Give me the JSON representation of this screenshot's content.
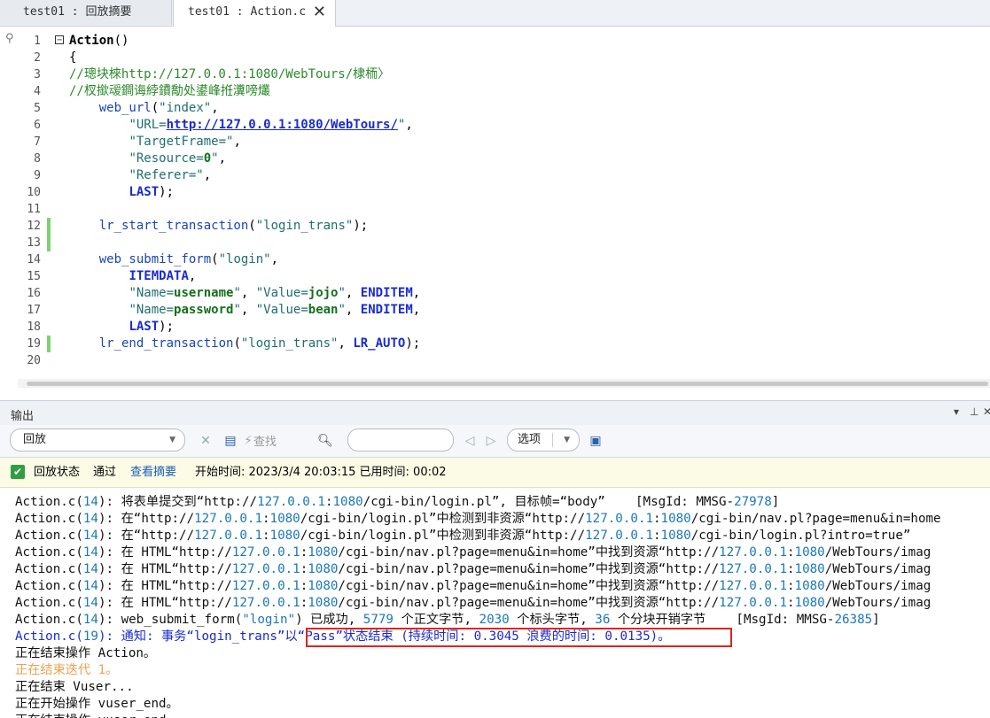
{
  "tabs": [
    {
      "label": "test01 : 回放摘要",
      "active": false
    },
    {
      "label": "test01 : Action.c",
      "active": true
    }
  ],
  "editor": {
    "lines": [
      {
        "num": "1",
        "parts": [
          {
            "t": "Action",
            "c": "k-fn"
          },
          {
            "t": "()",
            "c": ""
          }
        ]
      },
      {
        "num": "2",
        "parts": [
          {
            "t": "{",
            "c": ""
          }
        ]
      },
      {
        "num": "3",
        "parts": [
          {
            "t": "//璁块棶http://127.0.0.1:1080/WebTours/棣栭〉",
            "c": "k-cmt"
          }
        ]
      },
      {
        "num": "4",
        "parts": [
          {
            "t": "//杈撳叆鐧诲綍鐨勪处鍙峰拰瀵嗙爜",
            "c": "k-cmt"
          }
        ]
      },
      {
        "num": "5",
        "parts": [
          {
            "t": "    ",
            "c": ""
          },
          {
            "t": "web_url",
            "c": "k-call"
          },
          {
            "t": "(",
            "c": ""
          },
          {
            "t": "\"index\"",
            "c": "k-str"
          },
          {
            "t": ",",
            "c": ""
          }
        ]
      },
      {
        "num": "6",
        "parts": [
          {
            "t": "        ",
            "c": ""
          },
          {
            "t": "\"URL=",
            "c": "k-str"
          },
          {
            "t": "http://127.0.0.1:1080/WebTours/",
            "c": "k-url"
          },
          {
            "t": "\"",
            "c": "k-str"
          },
          {
            "t": ",",
            "c": ""
          }
        ]
      },
      {
        "num": "7",
        "parts": [
          {
            "t": "        ",
            "c": ""
          },
          {
            "t": "\"TargetFrame=\"",
            "c": "k-str"
          },
          {
            "t": ",",
            "c": ""
          }
        ]
      },
      {
        "num": "8",
        "parts": [
          {
            "t": "        ",
            "c": ""
          },
          {
            "t": "\"Resource=",
            "c": "k-str"
          },
          {
            "t": "0",
            "c": "k-bold"
          },
          {
            "t": "\"",
            "c": "k-str"
          },
          {
            "t": ",",
            "c": ""
          }
        ]
      },
      {
        "num": "9",
        "parts": [
          {
            "t": "        ",
            "c": ""
          },
          {
            "t": "\"Referer=\"",
            "c": "k-str"
          },
          {
            "t": ",",
            "c": ""
          }
        ]
      },
      {
        "num": "10",
        "parts": [
          {
            "t": "        ",
            "c": ""
          },
          {
            "t": "LAST",
            "c": "k-kw"
          },
          {
            "t": ");",
            "c": ""
          }
        ]
      },
      {
        "num": "11",
        "parts": []
      },
      {
        "num": "12",
        "parts": [
          {
            "t": "    ",
            "c": ""
          },
          {
            "t": "lr_start_transaction",
            "c": "k-call"
          },
          {
            "t": "(",
            "c": ""
          },
          {
            "t": "\"login_trans\"",
            "c": "k-str"
          },
          {
            "t": ");",
            "c": ""
          }
        ]
      },
      {
        "num": "13",
        "parts": []
      },
      {
        "num": "14",
        "parts": [
          {
            "t": "    ",
            "c": ""
          },
          {
            "t": "web_submit_form",
            "c": "k-call"
          },
          {
            "t": "(",
            "c": ""
          },
          {
            "t": "\"login\"",
            "c": "k-str"
          },
          {
            "t": ",",
            "c": ""
          }
        ]
      },
      {
        "num": "15",
        "parts": [
          {
            "t": "        ",
            "c": ""
          },
          {
            "t": "ITEMDATA",
            "c": "k-kw"
          },
          {
            "t": ",",
            "c": ""
          }
        ]
      },
      {
        "num": "16",
        "parts": [
          {
            "t": "        ",
            "c": ""
          },
          {
            "t": "\"Name=",
            "c": "k-str"
          },
          {
            "t": "username",
            "c": "k-bold"
          },
          {
            "t": "\"",
            "c": "k-str"
          },
          {
            "t": ", ",
            "c": ""
          },
          {
            "t": "\"Value=",
            "c": "k-str"
          },
          {
            "t": "jojo",
            "c": "k-bold"
          },
          {
            "t": "\"",
            "c": "k-str"
          },
          {
            "t": ", ",
            "c": ""
          },
          {
            "t": "ENDITEM",
            "c": "k-kw"
          },
          {
            "t": ",",
            "c": ""
          }
        ]
      },
      {
        "num": "17",
        "parts": [
          {
            "t": "        ",
            "c": ""
          },
          {
            "t": "\"Name=",
            "c": "k-str"
          },
          {
            "t": "password",
            "c": "k-bold"
          },
          {
            "t": "\"",
            "c": "k-str"
          },
          {
            "t": ", ",
            "c": ""
          },
          {
            "t": "\"Value=",
            "c": "k-str"
          },
          {
            "t": "bean",
            "c": "k-bold"
          },
          {
            "t": "\"",
            "c": "k-str"
          },
          {
            "t": ", ",
            "c": ""
          },
          {
            "t": "ENDITEM",
            "c": "k-kw"
          },
          {
            "t": ",",
            "c": ""
          }
        ]
      },
      {
        "num": "18",
        "parts": [
          {
            "t": "        ",
            "c": ""
          },
          {
            "t": "LAST",
            "c": "k-kw"
          },
          {
            "t": ");",
            "c": ""
          }
        ]
      },
      {
        "num": "19",
        "parts": [
          {
            "t": "    ",
            "c": ""
          },
          {
            "t": "lr_end_transaction",
            "c": "k-call"
          },
          {
            "t": "(",
            "c": ""
          },
          {
            "t": "\"login_trans\"",
            "c": "k-str"
          },
          {
            "t": ", ",
            "c": ""
          },
          {
            "t": "LR_AUTO",
            "c": "k-kw"
          },
          {
            "t": ");",
            "c": ""
          }
        ]
      },
      {
        "num": "20",
        "parts": []
      }
    ],
    "changed_lines": [
      "12",
      "13",
      "19"
    ]
  },
  "output": {
    "title": "输出",
    "toolbar": {
      "mode": "回放",
      "find_label": "查找",
      "search_placeholder": "",
      "options_label": "选项"
    },
    "status": {
      "label": "回放状态",
      "result": "通过",
      "summary_link": "查看摘要",
      "start_time": "开始时间: 2023/3/4 20:03:15 已用时间: 00:02"
    },
    "log_lines": [
      [
        {
          "t": "Action.c(",
          "c": ""
        },
        {
          "t": "14",
          "c": "n"
        },
        {
          "t": "): 将表单提交到“http://",
          "c": ""
        },
        {
          "t": "127.0.0.1",
          "c": "n"
        },
        {
          "t": ":",
          "c": ""
        },
        {
          "t": "1080",
          "c": "n"
        },
        {
          "t": "/cgi-bin/login.pl”, 目标帧=“body”    [MsgId: MMSG-",
          "c": ""
        },
        {
          "t": "27978",
          "c": "n"
        },
        {
          "t": "]",
          "c": ""
        }
      ],
      [
        {
          "t": "Action.c(",
          "c": ""
        },
        {
          "t": "14",
          "c": "n"
        },
        {
          "t": "): 在“http://",
          "c": ""
        },
        {
          "t": "127.0.0.1",
          "c": "n"
        },
        {
          "t": ":",
          "c": ""
        },
        {
          "t": "1080",
          "c": "n"
        },
        {
          "t": "/cgi-bin/login.pl”中检测到非资源“http://",
          "c": ""
        },
        {
          "t": "127.0.0.1",
          "c": "n"
        },
        {
          "t": ":",
          "c": ""
        },
        {
          "t": "1080",
          "c": "n"
        },
        {
          "t": "/cgi-bin/nav.pl?page=menu&in=home",
          "c": ""
        }
      ],
      [
        {
          "t": "Action.c(",
          "c": ""
        },
        {
          "t": "14",
          "c": "n"
        },
        {
          "t": "): 在“http://",
          "c": ""
        },
        {
          "t": "127.0.0.1",
          "c": "n"
        },
        {
          "t": ":",
          "c": ""
        },
        {
          "t": "1080",
          "c": "n"
        },
        {
          "t": "/cgi-bin/login.pl”中检测到非资源“http://",
          "c": ""
        },
        {
          "t": "127.0.0.1",
          "c": "n"
        },
        {
          "t": ":",
          "c": ""
        },
        {
          "t": "1080",
          "c": "n"
        },
        {
          "t": "/cgi-bin/login.pl?intro=true”",
          "c": ""
        }
      ],
      [
        {
          "t": "Action.c(",
          "c": ""
        },
        {
          "t": "14",
          "c": "n"
        },
        {
          "t": "): 在 HTML“http://",
          "c": ""
        },
        {
          "t": "127.0.0.1",
          "c": "n"
        },
        {
          "t": ":",
          "c": ""
        },
        {
          "t": "1080",
          "c": "n"
        },
        {
          "t": "/cgi-bin/nav.pl?page=menu&in=home”中找到资源“http://",
          "c": ""
        },
        {
          "t": "127.0.0.1",
          "c": "n"
        },
        {
          "t": ":",
          "c": ""
        },
        {
          "t": "1080",
          "c": "n"
        },
        {
          "t": "/WebTours/imag",
          "c": ""
        }
      ],
      [
        {
          "t": "Action.c(",
          "c": ""
        },
        {
          "t": "14",
          "c": "n"
        },
        {
          "t": "): 在 HTML“http://",
          "c": ""
        },
        {
          "t": "127.0.0.1",
          "c": "n"
        },
        {
          "t": ":",
          "c": ""
        },
        {
          "t": "1080",
          "c": "n"
        },
        {
          "t": "/cgi-bin/nav.pl?page=menu&in=home”中找到资源“http://",
          "c": ""
        },
        {
          "t": "127.0.0.1",
          "c": "n"
        },
        {
          "t": ":",
          "c": ""
        },
        {
          "t": "1080",
          "c": "n"
        },
        {
          "t": "/WebTours/imag",
          "c": ""
        }
      ],
      [
        {
          "t": "Action.c(",
          "c": ""
        },
        {
          "t": "14",
          "c": "n"
        },
        {
          "t": "): 在 HTML“http://",
          "c": ""
        },
        {
          "t": "127.0.0.1",
          "c": "n"
        },
        {
          "t": ":",
          "c": ""
        },
        {
          "t": "1080",
          "c": "n"
        },
        {
          "t": "/cgi-bin/nav.pl?page=menu&in=home”中找到资源“http://",
          "c": ""
        },
        {
          "t": "127.0.0.1",
          "c": "n"
        },
        {
          "t": ":",
          "c": ""
        },
        {
          "t": "1080",
          "c": "n"
        },
        {
          "t": "/WebTours/imag",
          "c": ""
        }
      ],
      [
        {
          "t": "Action.c(",
          "c": ""
        },
        {
          "t": "14",
          "c": "n"
        },
        {
          "t": "): 在 HTML“http://",
          "c": ""
        },
        {
          "t": "127.0.0.1",
          "c": "n"
        },
        {
          "t": ":",
          "c": ""
        },
        {
          "t": "1080",
          "c": "n"
        },
        {
          "t": "/cgi-bin/nav.pl?page=menu&in=home”中找到资源“http://",
          "c": ""
        },
        {
          "t": "127.0.0.1",
          "c": "n"
        },
        {
          "t": ":",
          "c": ""
        },
        {
          "t": "1080",
          "c": "n"
        },
        {
          "t": "/WebTours/imag",
          "c": ""
        }
      ],
      [
        {
          "t": "Action.c(",
          "c": ""
        },
        {
          "t": "14",
          "c": "n"
        },
        {
          "t": "): web_submit_form(",
          "c": ""
        },
        {
          "t": "\"login\"",
          "c": "n"
        },
        {
          "t": ") 已成功, ",
          "c": ""
        },
        {
          "t": "5779",
          "c": "n"
        },
        {
          "t": " 个正文字节, ",
          "c": ""
        },
        {
          "t": "2030",
          "c": "n"
        },
        {
          "t": " 个标头字节, ",
          "c": ""
        },
        {
          "t": "36",
          "c": "n"
        },
        {
          "t": " 个分块开销字节    [MsgId: MMSG-",
          "c": ""
        },
        {
          "t": "26385",
          "c": "n"
        },
        {
          "t": "]",
          "c": ""
        }
      ],
      [
        {
          "t": "Action.c(",
          "c": "blue"
        },
        {
          "t": "19",
          "c": "n"
        },
        {
          "t": "): 通知: 事务“login_trans”以“Pass”状态结束 (持续时间: ",
          "c": "blue"
        },
        {
          "t": "0.3045",
          "c": "blue"
        },
        {
          "t": " 浪费的时间: ",
          "c": "blue"
        },
        {
          "t": "0.0135",
          "c": "blue"
        },
        {
          "t": ")。",
          "c": "blue"
        }
      ],
      [
        {
          "t": "正在结束操作 Action。",
          "c": ""
        }
      ],
      [
        {
          "t": "正在结束迭代 1。",
          "c": "orange"
        }
      ],
      [
        {
          "t": "正在结束 Vuser...",
          "c": ""
        }
      ],
      [
        {
          "t": "正在开始操作 vuser_end。",
          "c": ""
        }
      ],
      [
        {
          "t": "正在结束操作 vuser_end。",
          "c": ""
        }
      ]
    ]
  },
  "colors": {
    "highlight_box": "#e0241c",
    "status_bg": "#fbfbe6",
    "pass_icon": "#2f9e44"
  }
}
